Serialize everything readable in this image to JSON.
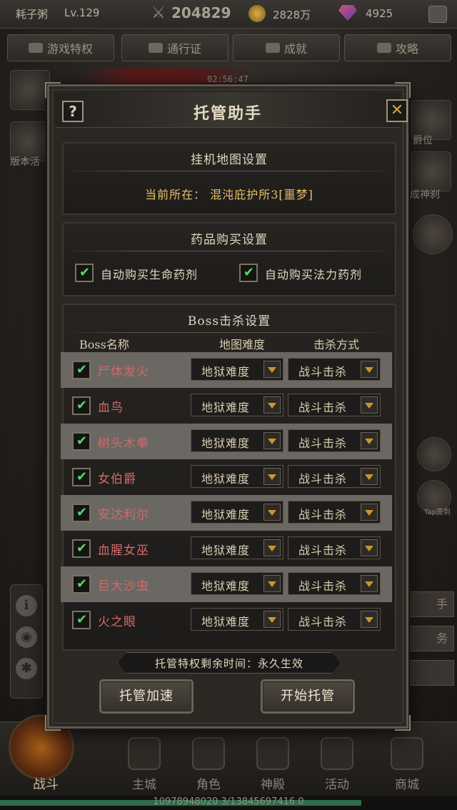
{
  "hud": {
    "player_name": "耗子粥",
    "level": "Lv.129",
    "power": "204829",
    "gold": "2828万",
    "gems": "4925",
    "timer": "02:56:47"
  },
  "top_nav": [
    {
      "label": "游戏特权"
    },
    {
      "label": "通行证"
    },
    {
      "label": "成就"
    },
    {
      "label": "攻略"
    }
  ],
  "side_labels": {
    "left_top": "版本活",
    "right_1": "爵位",
    "right_2": "成神刹",
    "right_tap": "Tap签到",
    "right_btn_1": "手",
    "right_btn_2": "务"
  },
  "bottom_nav": {
    "battle": "战斗",
    "items": [
      {
        "label": "主城"
      },
      {
        "label": "角色"
      },
      {
        "label": "神殿"
      },
      {
        "label": "活动"
      },
      {
        "label": "商城"
      }
    ],
    "exp_text": "10978948020 3/13845697416 0",
    "exp_fraction": 0.79
  },
  "dialog": {
    "title": "托管助手",
    "help_label": "?",
    "close_label": "✕",
    "map_section": {
      "header": "挂机地图设置",
      "current_location": "当前所在：   混沌庇护所3[噩梦]"
    },
    "potion_section": {
      "header": "药品购买设置",
      "options": [
        {
          "label": "自动购买生命药剂",
          "checked": true
        },
        {
          "label": "自动购买法力药剂",
          "checked": true
        }
      ]
    },
    "boss_section": {
      "header": "Boss击杀设置",
      "columns": {
        "name": "Boss名称",
        "difficulty": "地图难度",
        "kill_mode": "击杀方式"
      },
      "rows": [
        {
          "name": "尸体发火",
          "difficulty": "地狱难度",
          "kill_mode": "战斗击杀",
          "checked": true
        },
        {
          "name": "血鸟",
          "difficulty": "地狱难度",
          "kill_mode": "战斗击杀",
          "checked": true
        },
        {
          "name": "树头木拳",
          "difficulty": "地狱难度",
          "kill_mode": "战斗击杀",
          "checked": true
        },
        {
          "name": "女伯爵",
          "difficulty": "地狱难度",
          "kill_mode": "战斗击杀",
          "checked": true
        },
        {
          "name": "安达利尔",
          "difficulty": "地狱难度",
          "kill_mode": "战斗击杀",
          "checked": true
        },
        {
          "name": "血腥女巫",
          "difficulty": "地狱难度",
          "kill_mode": "战斗击杀",
          "checked": true
        },
        {
          "name": "巨大沙虫",
          "difficulty": "地狱难度",
          "kill_mode": "战斗击杀",
          "checked": true
        },
        {
          "name": "火之眼",
          "difficulty": "地狱难度",
          "kill_mode": "战斗击杀",
          "checked": true
        }
      ]
    },
    "privilege_text": "托管特权剩余时间：永久生效",
    "buttons": {
      "speed_up": "托管加速",
      "start": "开始托管"
    }
  },
  "colors": {
    "boss_name": "#d06a6a",
    "location": "#e8c068",
    "check": "#5ad66a",
    "dropdown_arrow": "#c8962a"
  }
}
